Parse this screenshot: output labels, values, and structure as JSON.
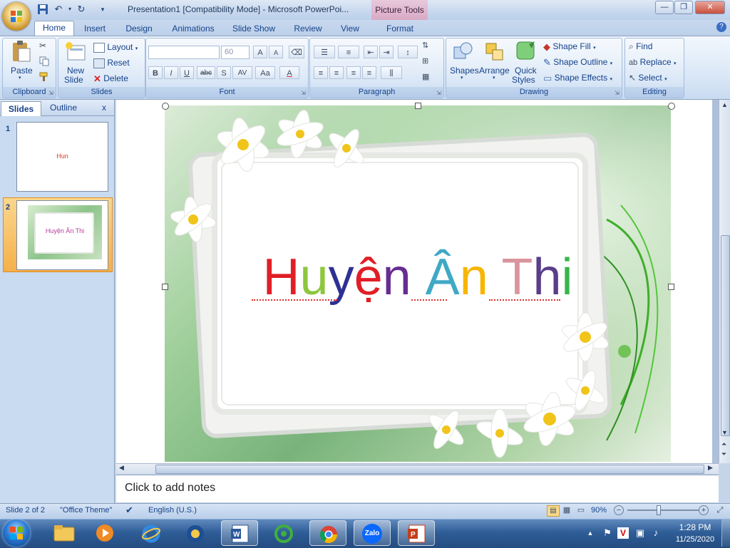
{
  "window": {
    "title": "Presentation1 [Compatibility Mode] - Microsoft PowerPoi...",
    "contextual_tab_group": "Picture Tools",
    "minimize": "—",
    "maximize": "❐",
    "close": "✕"
  },
  "tabs": [
    "Home",
    "Insert",
    "Design",
    "Animations",
    "Slide Show",
    "Review",
    "View",
    "Format"
  ],
  "help": "?",
  "ribbon": {
    "clipboard": {
      "label": "Clipboard",
      "paste": "Paste"
    },
    "slides": {
      "label": "Slides",
      "new_slide_1": "New",
      "new_slide_2": "Slide",
      "layout": "Layout",
      "reset": "Reset",
      "delete": "Delete"
    },
    "font": {
      "label": "Font",
      "font_size": "60",
      "bold": "B",
      "italic": "I",
      "underline": "U",
      "strike": "abc",
      "shadow": "S",
      "spacing": "AV",
      "case": "Aa",
      "color": "A",
      "grow": "A",
      "shrink": "A"
    },
    "paragraph": {
      "label": "Paragraph"
    },
    "drawing": {
      "label": "Drawing",
      "shapes": "Shapes",
      "arrange": "Arrange",
      "quick_styles_1": "Quick",
      "quick_styles_2": "Styles",
      "shape_fill": "Shape Fill",
      "shape_outline": "Shape Outline",
      "shape_effects": "Shape Effects"
    },
    "editing": {
      "label": "Editing",
      "find": "Find",
      "replace": "Replace",
      "select": "Select"
    }
  },
  "left_panel": {
    "tab_slides": "Slides",
    "tab_outline": "Outline",
    "close": "x",
    "thumbs": [
      {
        "number": "1",
        "text": "Hun"
      },
      {
        "number": "2",
        "text": "Huyện Ân Thi"
      }
    ]
  },
  "slide": {
    "title_letters": [
      {
        "ch": "H",
        "color": "#e01f26"
      },
      {
        "ch": "u",
        "color": "#8dc63f"
      },
      {
        "ch": "y",
        "color": "#2e3192"
      },
      {
        "ch": "ệ",
        "color": "#e01f26"
      },
      {
        "ch": "n",
        "color": "#662d91"
      },
      {
        "ch": " ",
        "color": "#000000"
      },
      {
        "ch": "Â",
        "color": "#3fa9c5"
      },
      {
        "ch": "n",
        "color": "#f7b500"
      },
      {
        "ch": " ",
        "color": "#000000"
      },
      {
        "ch": "T",
        "color": "#d9959d"
      },
      {
        "ch": "h",
        "color": "#5a3e8a"
      },
      {
        "ch": "i",
        "color": "#39b54a"
      }
    ]
  },
  "notes": {
    "placeholder": "Click to add notes"
  },
  "status": {
    "slide_of": "Slide 2 of 2",
    "theme": "\"Office Theme\"",
    "language": "English (U.S.)",
    "zoom": "90%",
    "zoom_fraction": 0.9
  },
  "taskbar": {
    "time": "1:28 PM",
    "date": "11/25/2020",
    "zalo": "Zalo"
  },
  "colors": {
    "accent": "#15428b",
    "selection": "#f5b04b"
  }
}
